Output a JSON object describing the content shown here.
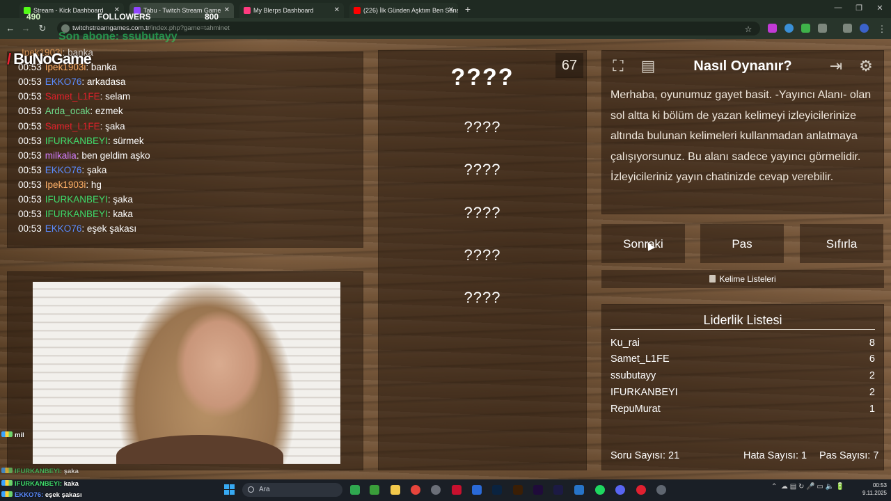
{
  "browser": {
    "tabs": [
      {
        "title": "Stream - Kick Dashboard",
        "color": "#53fc18",
        "active": false
      },
      {
        "title": "Tabu - Twitch Stream Game",
        "color": "#9146ff",
        "active": true
      },
      {
        "title": "My Blerps Dashboard",
        "color": "#ff3b7f",
        "active": false
      },
      {
        "title": "(226) İlk Günden Aşktım Ben Sana",
        "color": "#ff0000",
        "active": false
      }
    ],
    "url_domain": "twitchstreamgames.com.tr",
    "url_path": "/index.php?game=tahminet",
    "window_controls": [
      "—",
      "❐",
      "✕"
    ]
  },
  "overlay": {
    "followers_count_left": "490",
    "followers_label": "FOLLOWERS",
    "followers_count_right": "800",
    "last_sub": "Son abone: ssubutayy",
    "brand": "BuNoGame"
  },
  "chat": [
    {
      "time": "",
      "user": "Ipek1903i",
      "msg": "banka",
      "color": "#ffb067"
    },
    {
      "time": "00:53",
      "user": "Ipek1903i",
      "msg": "banka",
      "color": "#ffb067"
    },
    {
      "time": "00:53",
      "user": "EKKO76",
      "msg": "arkadasa",
      "color": "#5b8cff"
    },
    {
      "time": "00:53",
      "user": "Samet_L1FE",
      "msg": "selam",
      "color": "#e0202a"
    },
    {
      "time": "00:53",
      "user": "Arda_ocak",
      "msg": "ezmek",
      "color": "#6fdd8b"
    },
    {
      "time": "00:53",
      "user": "Samet_L1FE",
      "msg": "şaka",
      "color": "#e0202a"
    },
    {
      "time": "00:53",
      "user": "IFURKANBEYI",
      "msg": "sürmek",
      "color": "#3fdc6c"
    },
    {
      "time": "00:53",
      "user": "milkalia",
      "msg": "ben geldim aşko",
      "color": "#d27cff"
    },
    {
      "time": "00:53",
      "user": "EKKO76",
      "msg": "şaka",
      "color": "#5b8cff"
    },
    {
      "time": "00:53",
      "user": "Ipek1903i",
      "msg": "hg",
      "color": "#ffb067"
    },
    {
      "time": "00:53",
      "user": "IFURKANBEYI",
      "msg": "şaka",
      "color": "#3fdc6c"
    },
    {
      "time": "00:53",
      "user": "IFURKANBEYI",
      "msg": "kaka",
      "color": "#3fdc6c"
    },
    {
      "time": "00:53",
      "user": "EKKO76",
      "msg": "eşek şakası",
      "color": "#5b8cff"
    }
  ],
  "game": {
    "counter": "67",
    "words": [
      "????",
      "????",
      "????",
      "????",
      "????",
      "????"
    ],
    "how_title": "Nasıl Oynanır?",
    "how_text": "Merhaba, oyunumuz gayet basit. -Yayıncı Alanı- olan sol altta ki bölüm de yazan kelimeyi izleyicilerinize altında bulunan kelimeleri kullanmadan anlatmaya çalışıyorsunuz. Bu alanı sadece yayıncı görmelidir. İzleyicileriniz yayın chatinizde cevap verebilir.",
    "buttons": {
      "next": "Sonraki",
      "pass": "Pas",
      "reset": "Sıfırla"
    },
    "word_lists": "Kelime Listeleri",
    "leaderboard_title": "Liderlik Listesi",
    "leaderboard": [
      {
        "name": "Ku_rai",
        "score": "8"
      },
      {
        "name": "Samet_L1FE",
        "score": "6"
      },
      {
        "name": "ssubutayy",
        "score": "2"
      },
      {
        "name": "IFURKANBEYI",
        "score": "2"
      },
      {
        "name": "RepuMurat",
        "score": "1"
      }
    ],
    "stats": {
      "questions": "Soru Sayısı: 21",
      "errors": "Hata Sayısı: 1",
      "passes": "Pas Sayısı: 7"
    }
  },
  "mini_chat": [
    {
      "user": "mil",
      "msg": ""
    },
    {
      "user": "IFURKANBEYI",
      "msg": "şaka"
    },
    {
      "user": "IFURKANBEYI",
      "msg": "kaka"
    },
    {
      "user": "EKKO76",
      "msg": "eşek şakası"
    }
  ],
  "taskbar": {
    "search_placeholder": "Ara",
    "time": "00:53",
    "date": "9.11.2025"
  }
}
